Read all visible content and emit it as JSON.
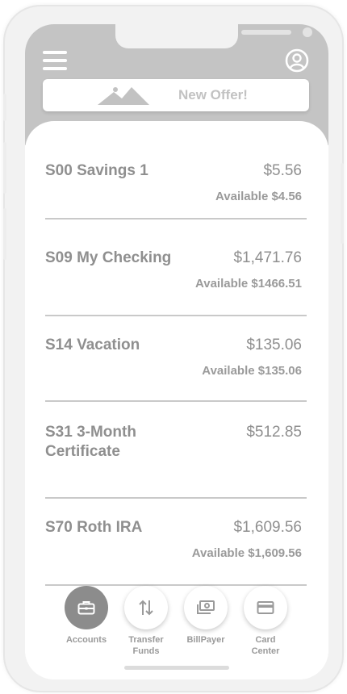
{
  "header": {
    "menu_icon": "hamburger-menu-icon",
    "profile_icon": "user-circle-icon",
    "offer_icon": "image-mountain-icon",
    "offer_label": "New Offer!"
  },
  "accounts": [
    {
      "name": "S00 Savings 1",
      "balance": "$5.56",
      "available": "Available $4.56"
    },
    {
      "name": "S09 My Checking",
      "balance": "$1,471.76",
      "available": "Available $1466.51"
    },
    {
      "name": "S14 Vacation",
      "balance": "$135.06",
      "available": "Available $135.06"
    },
    {
      "name": "S31 3-Month Certificate",
      "balance": "$512.85",
      "available": ""
    },
    {
      "name": "S70 Roth IRA",
      "balance": "$1,609.56",
      "available": "Available $1,609.56"
    }
  ],
  "nav": [
    {
      "label": "Accounts",
      "icon": "briefcase-icon",
      "active": true
    },
    {
      "label": "Transfer Funds",
      "icon": "transfer-arrows-icon",
      "active": false
    },
    {
      "label": "BillPayer",
      "icon": "cash-icon",
      "active": false
    },
    {
      "label": "Card Center",
      "icon": "credit-card-icon",
      "active": false
    }
  ],
  "colors": {
    "header_bg": "#c4c4c4",
    "text": "#8f8f8f",
    "active_nav": "#8c8c8c"
  }
}
